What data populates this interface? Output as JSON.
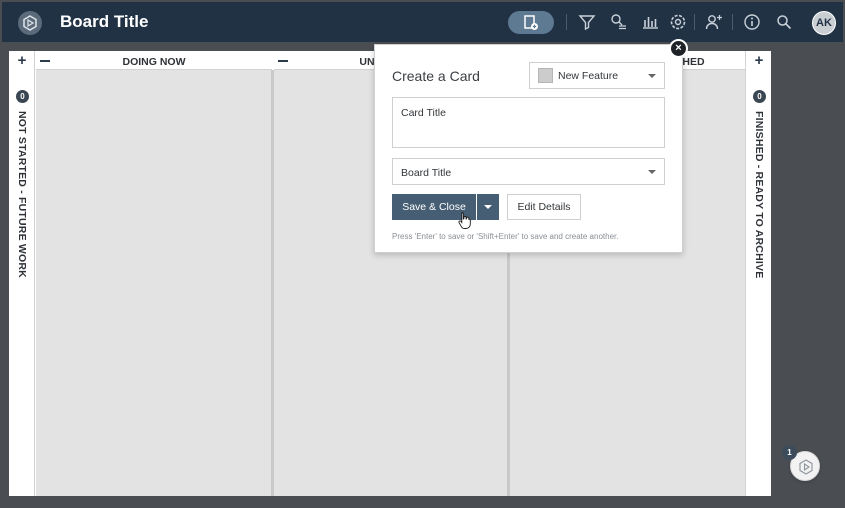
{
  "header": {
    "board_title": "Board Title",
    "icons": [
      "board-logo-icon",
      "add-card-icon",
      "filter-icon",
      "find-icon",
      "reports-icon",
      "settings-icon",
      "add-member-icon",
      "info-icon",
      "search-icon"
    ],
    "avatar_initials": "AK",
    "background_color": "#223245",
    "accent_color": "#5d7a92"
  },
  "lanes": {
    "left": {
      "label": "NOT STARTED - FUTURE WORK",
      "count": "0"
    },
    "right": {
      "label": "FINISHED - READY TO ARCHIVE",
      "count": "0"
    }
  },
  "columns": [
    {
      "title": "DOING NOW"
    },
    {
      "title": "UN"
    },
    {
      "title": "HED"
    }
  ],
  "create_card": {
    "title": "Create a Card",
    "card_type": "New Feature",
    "card_title_placeholder": "Card Title",
    "board_select": "Board Title",
    "save_label": "Save & Close",
    "edit_label": "Edit Details",
    "hint": "Press 'Enter' to save or 'Shift+Enter' to save and create another.",
    "close_symbol": "×",
    "button_color": "#465e73"
  },
  "floating": {
    "badge_count": "1"
  }
}
